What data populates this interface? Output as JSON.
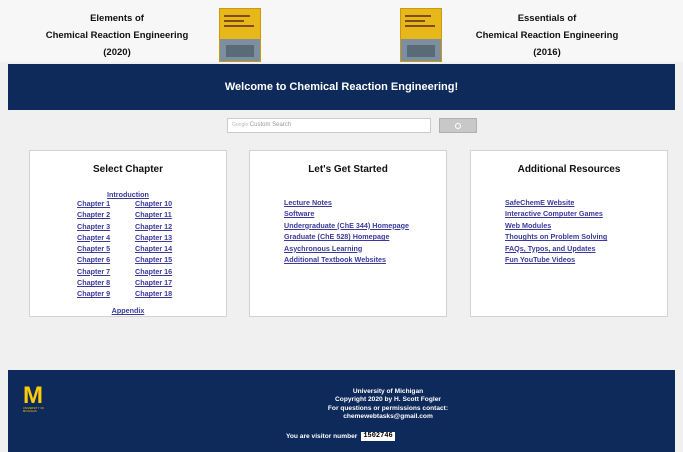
{
  "header": {
    "left_book": {
      "line1": "Elements of",
      "line2": "Chemical Reaction Engineering",
      "line3": "(2020)"
    },
    "right_book": {
      "line1": "Essentials of",
      "line2": "Chemical Reaction Engineering",
      "line3": "(2016)"
    },
    "cover_color": "#e8b719"
  },
  "banner": {
    "title": "Welcome to Chemical Reaction Engineering!",
    "color": "#0d2a5a"
  },
  "search": {
    "brand": "Google",
    "placeholder": "Custom Search"
  },
  "panels": {
    "chapter": {
      "title": "Select Chapter",
      "intro": "Introduction",
      "chapters": [
        "Chapter 1",
        "Chapter 10",
        "Chapter 2",
        "Chapter 11",
        "Chapter 3",
        "Chapter 12",
        "Chapter 4",
        "Chapter 13",
        "Chapter 5",
        "Chapter 14",
        "Chapter 6",
        "Chapter 15",
        "Chapter 7",
        "Chapter 16",
        "Chapter 8",
        "Chapter 17",
        "Chapter 9",
        "Chapter 18"
      ],
      "appendix": "Appendix"
    },
    "started": {
      "title": "Let's Get Started",
      "links": [
        "Lecture Notes",
        "Software",
        "Undergraduate (ChE 344) Homepage",
        "Graduate (ChE 528) Homepage",
        "Asychronous Learning",
        "Additional Textbook Websites"
      ]
    },
    "resources": {
      "title": "Additional Resources",
      "links": [
        "SafeChemE Website",
        "Interactive Computer Games",
        "Web Modules",
        "Thoughts on Problem Solving",
        "FAQs, Typos, and Updates",
        "Fun YouTube Videos"
      ]
    }
  },
  "footer": {
    "logo_letter": "M",
    "logo_sub": "UNIVERSITY OF MICHIGAN",
    "line1": "University of Michigan",
    "line2": "Copyright 2020 by H. Scott Fogler",
    "line3": "For questions or permissions contact:",
    "line4": "chemewebtasks@gmail.com",
    "visitor_label": "You are visitor number",
    "visitor_count": "1502746",
    "accent": "#ffcb05"
  },
  "link_color": "#3a3a9c"
}
